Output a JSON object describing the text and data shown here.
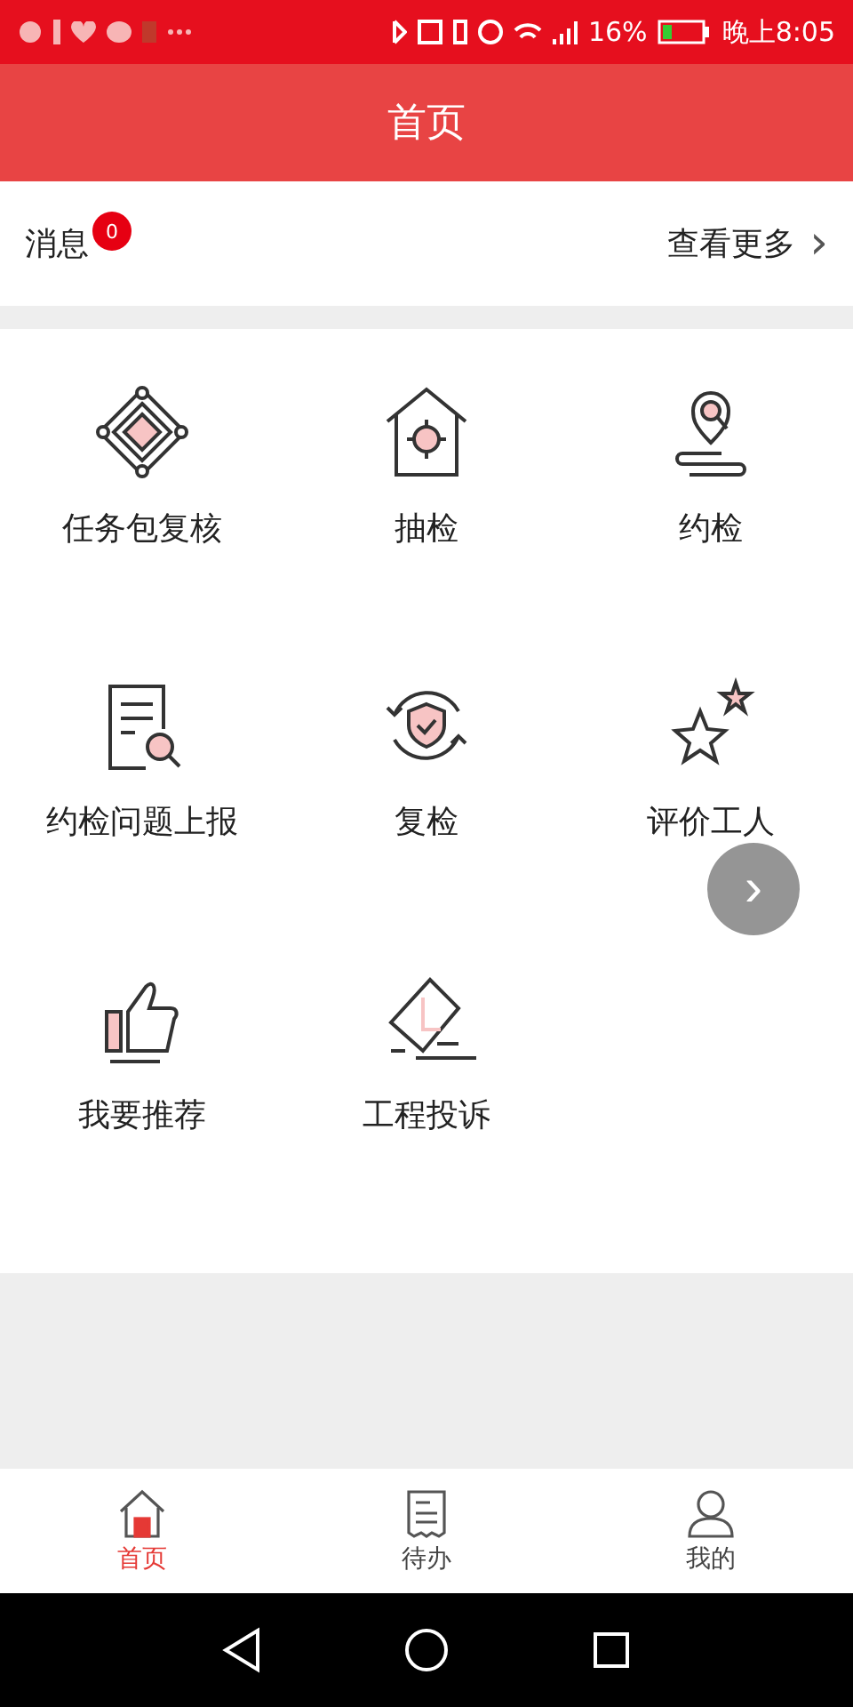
{
  "status_bar": {
    "battery": "16%",
    "time": "晚上8:05"
  },
  "header": {
    "title": "首页"
  },
  "messages": {
    "label": "消息",
    "badge": "0",
    "more": "查看更多",
    "more_icon": "›"
  },
  "grid": [
    {
      "kind": "package",
      "label": "任务包复核"
    },
    {
      "kind": "spot",
      "label": "抽检"
    },
    {
      "kind": "location",
      "label": "约检"
    },
    {
      "kind": "report",
      "label": "约检问题上报"
    },
    {
      "kind": "recheck",
      "label": "复检"
    },
    {
      "kind": "rate",
      "label": "评价工人"
    },
    {
      "kind": "recommend",
      "label": "我要推荐"
    },
    {
      "kind": "complaint",
      "label": "工程投诉"
    }
  ],
  "floating_button": {
    "label": "›"
  },
  "tab_bar": [
    {
      "kind": "home",
      "label": "首页",
      "selected": true
    },
    {
      "kind": "todo",
      "label": "待办",
      "selected": false
    },
    {
      "kind": "me",
      "label": "我的",
      "selected": false
    }
  ]
}
